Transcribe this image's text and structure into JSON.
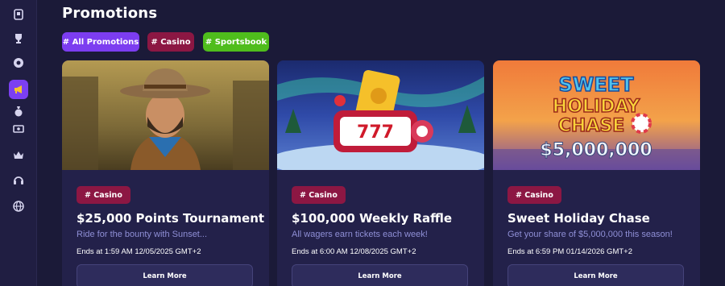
{
  "sidebar": {
    "items": [
      {
        "icon": "card-icon"
      },
      {
        "icon": "trophy-icon"
      },
      {
        "icon": "chip-icon"
      },
      {
        "icon": "megaphone-icon",
        "active": true
      },
      {
        "icon": "money-bag-icon"
      },
      {
        "icon": "cash-icon"
      },
      {
        "icon": "crown-icon"
      },
      {
        "icon": "headset-icon"
      },
      {
        "icon": "globe-icon"
      }
    ]
  },
  "page": {
    "title": "Promotions"
  },
  "filters": [
    {
      "label": "# All Promotions",
      "active": true
    },
    {
      "label": "# Casino"
    },
    {
      "label": "# Sportsbook"
    }
  ],
  "cards": [
    {
      "tag": "# Casino",
      "title": "$25,000 Points Tournament",
      "subtitle": "Ride for the bounty with Sunset...",
      "ends": "Ends at 1:59 AM 12/05/2025 GMT+2",
      "button": "Learn More"
    },
    {
      "tag": "# Casino",
      "title": "$100,000 Weekly Raffle",
      "subtitle": "All wagers earn tickets each week!",
      "ends": "Ends at 6:00 AM 12/08/2025 GMT+2",
      "button": "Learn More"
    },
    {
      "tag": "# Casino",
      "title": "Sweet Holiday Chase",
      "subtitle": "Get your share of $5,000,000 this season!",
      "ends": "Ends at 6:59 PM 01/14/2026 GMT+2",
      "button": "Learn More",
      "banner": {
        "line1": "SWEET",
        "line2": "HOLIDAY",
        "line3": "CHASE",
        "amount": "$5,000,000"
      }
    }
  ],
  "colors": {
    "accent": "#7c3df0",
    "casino": "#8c1743",
    "sportsbook": "#4fbd1c",
    "background": "#1b1a38"
  }
}
